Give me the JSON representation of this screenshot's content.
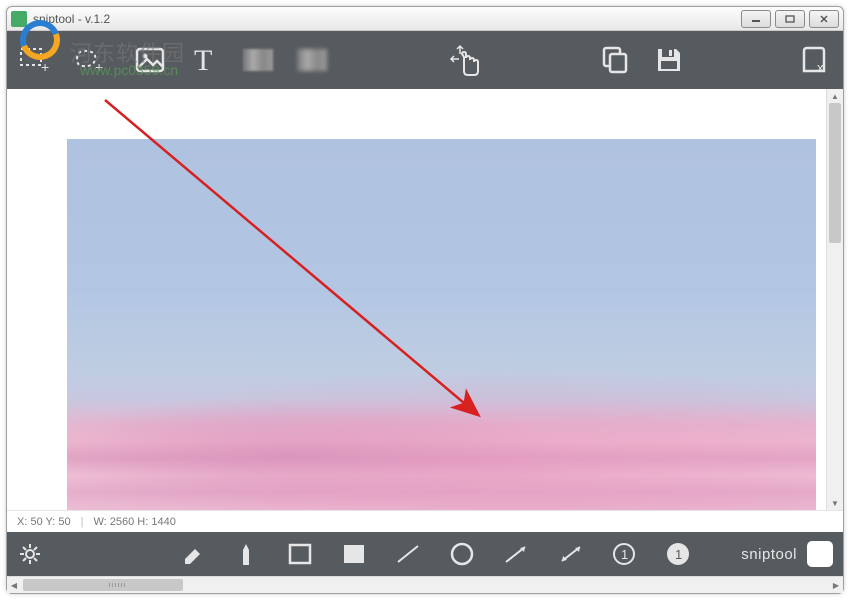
{
  "window": {
    "title": "sniptool - v.1.2"
  },
  "watermark": {
    "line1": "河东软件园",
    "line2": "www.pc0359.cn"
  },
  "status": {
    "xy_label": "X: 50 Y: 50",
    "wh_label": "W: 2560 H: 1440"
  },
  "brand": {
    "name": "sniptool"
  },
  "top_tools": {
    "rect_select": "rectangle-select",
    "free_select": "freeform-select",
    "image": "insert-image",
    "text": "text-tool",
    "blur1": "pixelate-1",
    "blur2": "pixelate-2",
    "pointer": "click-pointer",
    "copy": "copy",
    "save": "save",
    "clear": "delete"
  },
  "bottom_tools": {
    "settings": "settings",
    "eraser": "eraser",
    "pen": "pen",
    "rect_outline": "rectangle-outline",
    "rect_fill": "rectangle-fill",
    "line": "line",
    "circle": "circle",
    "arrow_thin": "arrow",
    "arrow_double": "double-arrow",
    "number_outline": "number-stamp-outline",
    "number_fill": "number-stamp-fill"
  },
  "colors": {
    "toolbar_bg": "#565b5f",
    "icon": "#e6e6e6",
    "arrow_annotation": "#d72020"
  }
}
